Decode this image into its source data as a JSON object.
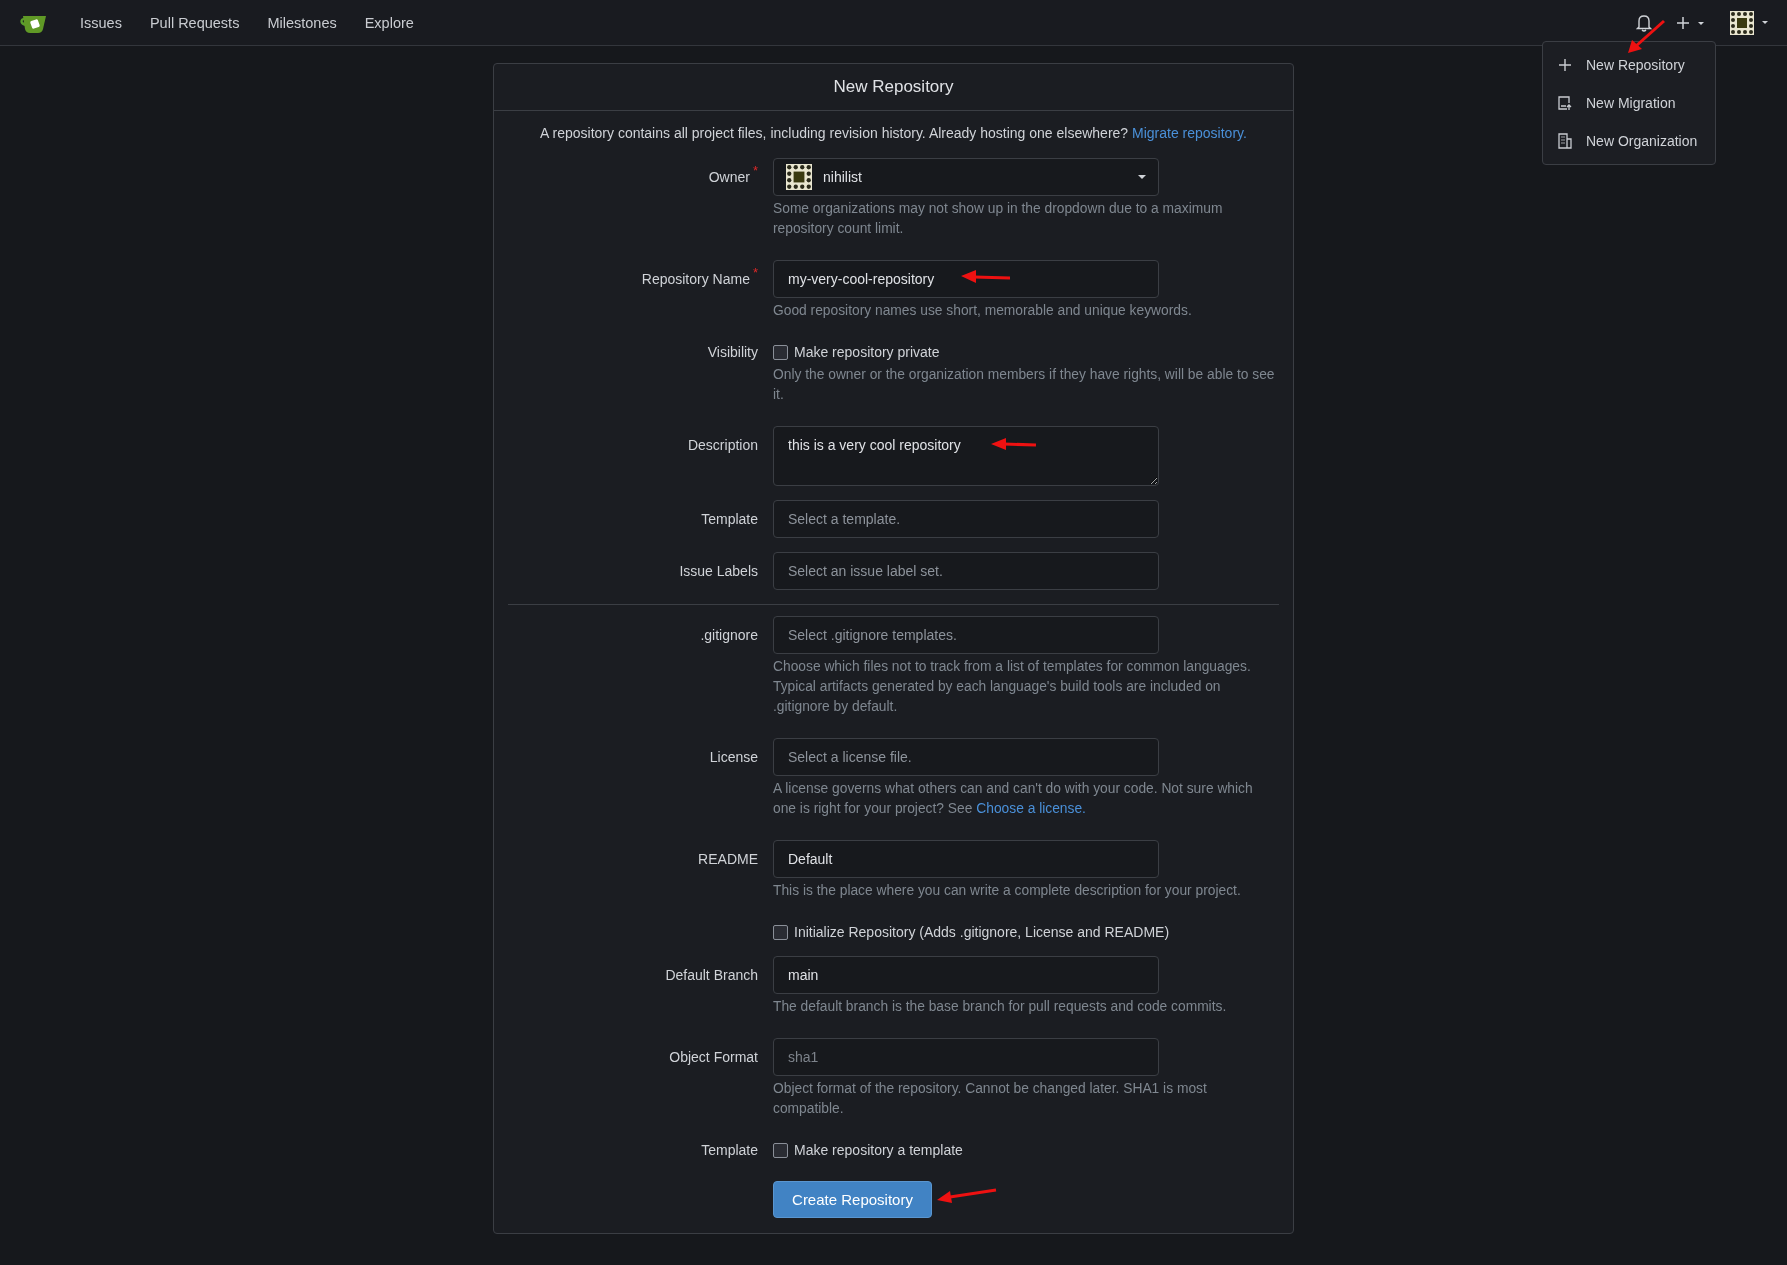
{
  "nav": {
    "items": [
      "Issues",
      "Pull Requests",
      "Milestones",
      "Explore"
    ]
  },
  "create_menu": {
    "items": [
      {
        "kind": "plus",
        "label": "New Repository"
      },
      {
        "kind": "migration",
        "label": "New Migration"
      },
      {
        "kind": "organization",
        "label": "New Organization"
      }
    ]
  },
  "form": {
    "title": "New Repository",
    "intro": "A repository contains all project files, including revision history. Already hosting one elsewhere?",
    "intro_link": "Migrate repository.",
    "rows": [
      {
        "kind": "owner",
        "label": "Owner",
        "required_mark": "*",
        "value": "nihilist",
        "help": "Some organizations may not show up in the dropdown due to a maximum repository count limit."
      },
      {
        "kind": "input",
        "label": "Repository Name",
        "required_mark": "*",
        "value": "my-very-cool-repository",
        "help": "Good repository names use short, memorable and unique keywords."
      },
      {
        "kind": "checkbox",
        "label": "Visibility",
        "text": "Make repository private",
        "checked": false,
        "help": "Only the owner or the organization members if they have rights, will be able to see it."
      },
      {
        "kind": "textarea",
        "label": "Description",
        "value": "this is a very cool repository"
      },
      {
        "kind": "select",
        "label": "Template",
        "placeholder": "Select a template."
      },
      {
        "kind": "select",
        "label": "Issue Labels",
        "placeholder": "Select an issue label set."
      },
      {
        "kind": "divider"
      },
      {
        "kind": "select",
        "label": ".gitignore",
        "placeholder": "Select .gitignore templates.",
        "help": "Choose which files not to track from a list of templates for common languages. Typical artifacts generated by each language's build tools are included on .gitignore by default."
      },
      {
        "kind": "select",
        "label": "License",
        "placeholder": "Select a license file.",
        "help": "A license governs what others can and can't do with your code. Not sure which one is right for your project? See",
        "help_link": "Choose a license."
      },
      {
        "kind": "select",
        "label": "README",
        "value": "Default",
        "help": "This is the place where you can write a complete description for your project."
      },
      {
        "kind": "checkbox",
        "text": "Initialize Repository (Adds .gitignore, License and README)",
        "checked": false
      },
      {
        "kind": "input",
        "label": "Default Branch",
        "value": "main",
        "help": "The default branch is the base branch for pull requests and code commits."
      },
      {
        "kind": "input",
        "label": "Object Format",
        "value": "sha1",
        "disabled": true,
        "help": "Object format of the repository. Cannot be changed later. SHA1 is most compatible."
      },
      {
        "kind": "checkbox",
        "label": "Template",
        "text": "Make repository a template",
        "checked": false
      }
    ],
    "submit": "Create Repository"
  }
}
